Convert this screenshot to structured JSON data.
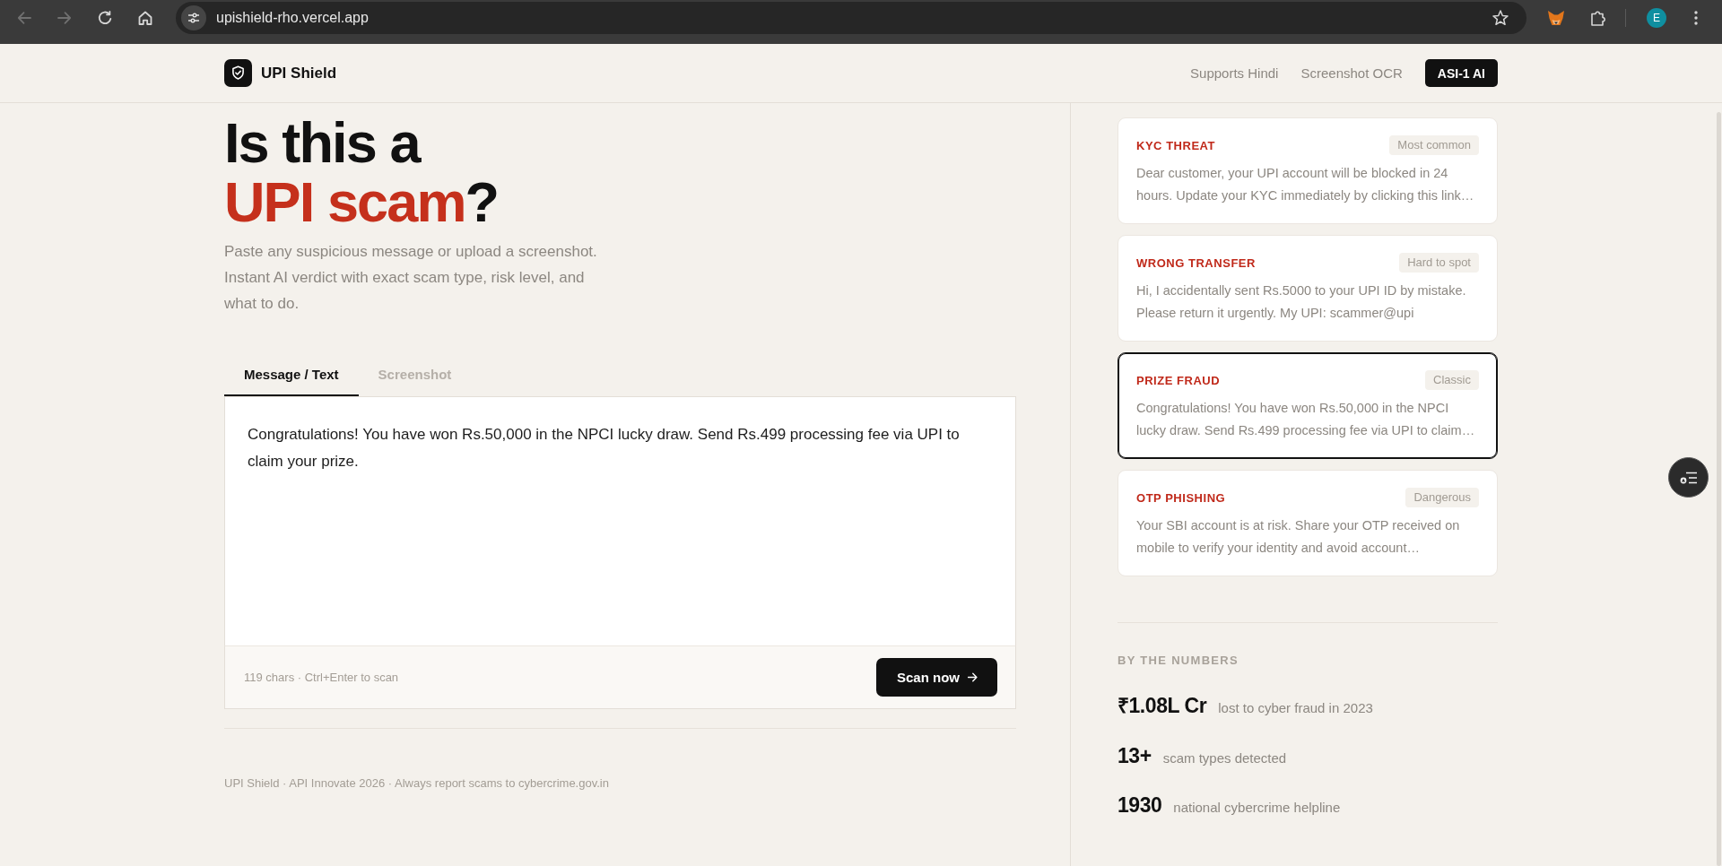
{
  "browser": {
    "nav_buttons": [
      {
        "kind": "back",
        "disabled": true
      },
      {
        "kind": "forward",
        "disabled": true
      },
      {
        "kind": "reload",
        "disabled": false
      },
      {
        "kind": "home",
        "disabled": false
      }
    ],
    "url": "upishield-rho.vercel.app",
    "profile_initial": "E"
  },
  "header": {
    "brand": "UPI Shield",
    "features": [
      "Supports Hindi",
      "Screenshot OCR"
    ],
    "badge": "ASI-1 AI"
  },
  "hero": {
    "title_line": "Is this a",
    "title_accent": "UPI scam",
    "title_end": "?",
    "subtitle": "Paste any suspicious message or upload a screenshot. Instant AI verdict with exact scam type, risk level, and what to do."
  },
  "tabs": [
    {
      "label": "Message / Text",
      "selected": true
    },
    {
      "label": "Screenshot",
      "selected": false
    }
  ],
  "composer": {
    "value": "Congratulations! You have won Rs.50,000 in the NPCI lucky draw. Send Rs.499 processing fee via UPI to claim your prize.",
    "hint": "119 chars · Ctrl+Enter to scan",
    "button": "Scan now"
  },
  "footer": "UPI Shield · API Innovate 2026 · Always report scams to cybercrime.gov.in",
  "examples": [
    {
      "title": "KYC THREAT",
      "tag": "Most common",
      "text": "Dear customer, your UPI account will be blocked in 24 hours. Update your KYC immediately by clicking this link…",
      "selected": false
    },
    {
      "title": "WRONG TRANSFER",
      "tag": "Hard to spot",
      "text": "Hi, I accidentally sent Rs.5000 to your UPI ID by mistake. Please return it urgently. My UPI: scammer@upi",
      "selected": false
    },
    {
      "title": "PRIZE FRAUD",
      "tag": "Classic",
      "text": "Congratulations! You have won Rs.50,000 in the NPCI lucky draw. Send Rs.499 processing fee via UPI to claim…",
      "selected": true
    },
    {
      "title": "OTP PHISHING",
      "tag": "Dangerous",
      "text": "Your SBI account is at risk. Share your OTP received on mobile to verify your identity and avoid account…",
      "selected": false
    }
  ],
  "stats": {
    "heading": "BY THE NUMBERS",
    "items": [
      {
        "value": "₹1.08L Cr",
        "label": "lost to cyber fraud in 2023"
      },
      {
        "value": "13+",
        "label": "scam types detected"
      },
      {
        "value": "1930",
        "label": "national cybercrime helpline"
      }
    ]
  }
}
